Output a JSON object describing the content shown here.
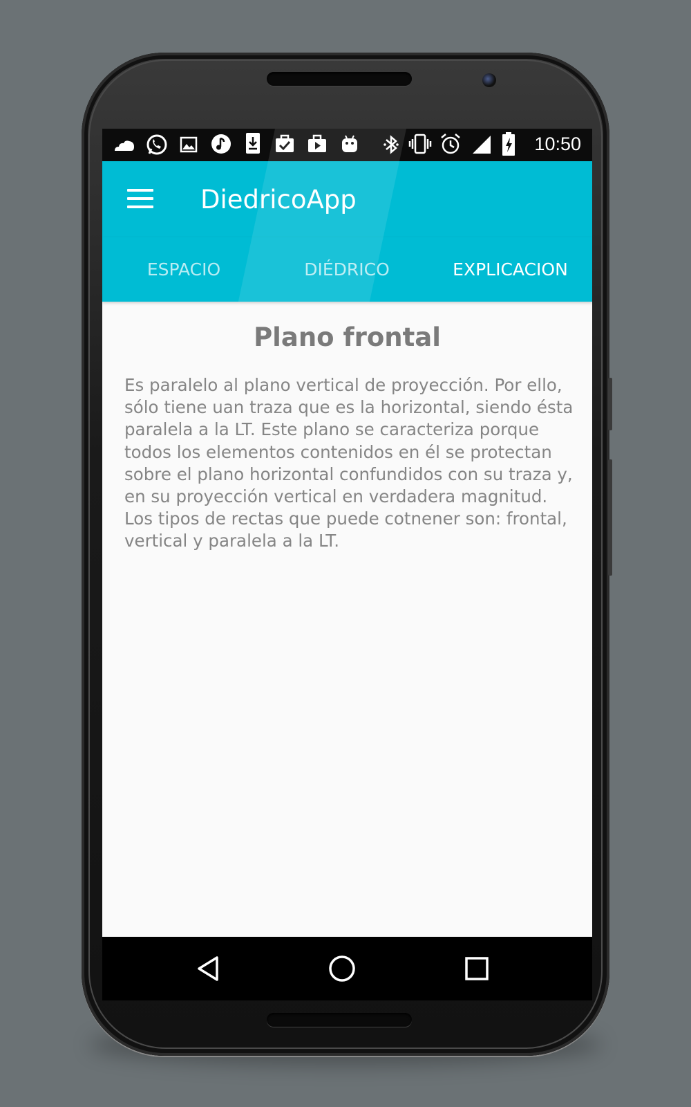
{
  "status_bar": {
    "time": "10:50",
    "left_icons": [
      "cloud-icon",
      "whatsapp-icon",
      "image-icon",
      "music-icon",
      "download-icon",
      "clipboard-check-icon",
      "briefcase-play-icon",
      "android-icon"
    ],
    "right_icons": [
      "bluetooth-icon",
      "vibrate-icon",
      "alarm-icon",
      "signal-icon",
      "battery-charging-icon"
    ]
  },
  "app_bar": {
    "title": "DiedricoApp",
    "menu_icon": "hamburger-menu-icon",
    "color": "#00bcd4"
  },
  "tabs": [
    {
      "label": "ESPACIO",
      "active": false
    },
    {
      "label": "DIÉDRICO",
      "active": false
    },
    {
      "label": "EXPLICACION",
      "active": true
    }
  ],
  "content": {
    "title": "Plano frontal",
    "body": "Es paralelo al plano vertical de proyección. Por ello, sólo tiene uan traza que es la horizontal, siendo ésta paralela a la LT. Este plano se caracteriza porque todos los elementos contenidos en él se protectan sobre el plano horizontal confundidos con su traza y, en su proyección vertical en verdadera magnitud. Los tipos de rectas que puede cotnener son: frontal, vertical y paralela a la LT."
  },
  "nav_bar": {
    "buttons": [
      "back-triangle-icon",
      "home-circle-icon",
      "recents-square-icon"
    ]
  }
}
